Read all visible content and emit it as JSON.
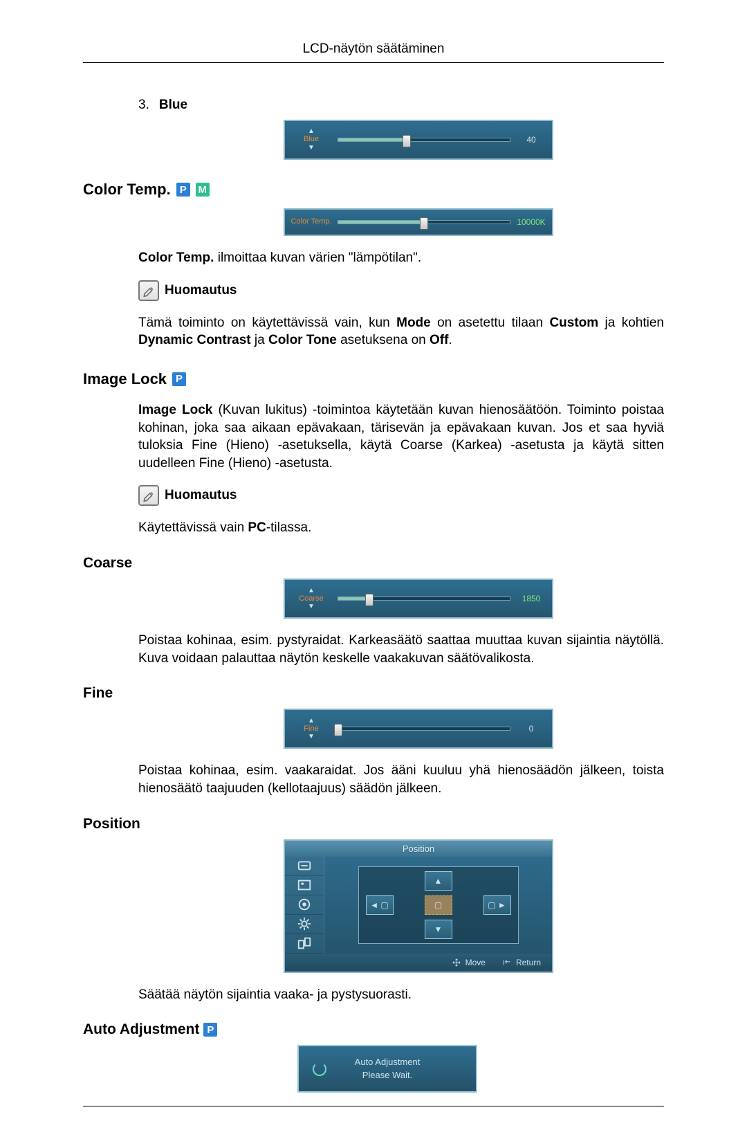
{
  "header": {
    "title": "LCD-näytön säätäminen"
  },
  "blue_item": {
    "num": "3.",
    "label": "Blue"
  },
  "blue_osd": {
    "label": "Blue",
    "value": "40",
    "percent": 40
  },
  "colortemp_heading": "Color Temp.",
  "colortemp_osd": {
    "label": "Color Temp.",
    "value": "10000K",
    "percent": 50
  },
  "colortemp_text_prefix": "Color Temp.",
  "colortemp_text_rest": " ilmoittaa kuvan värien \"lämpötilan\".",
  "note_label": "Huomautus",
  "colortemp_note": {
    "t1": "Tämä toiminto on käytettävissä vain, kun ",
    "b1": "Mode",
    "t2": " on asetettu tilaan ",
    "b2": "Custom",
    "t3": " ja kohtien ",
    "b3": "Dynamic Contrast",
    "t4": " ja ",
    "b4": "Color Tone",
    "t5": " asetuksena on ",
    "b5": "Off",
    "t6": "."
  },
  "imagelock_heading": "Image Lock",
  "imagelock_text": {
    "b1": "Image Lock",
    "rest": " (Kuvan lukitus) -toimintoa käytetään kuvan hienosäätöön. Toiminto poistaa kohinan, joka saa aikaan epävakaan, tärisevän ja epävakaan kuvan. Jos et saa hyviä tuloksia Fine (Hieno) -asetuksella, käytä Coarse (Karkea) -asetusta ja käytä sitten uudelleen Fine (Hieno) -asetusta."
  },
  "imagelock_note": {
    "t1": "Käytettävissä vain ",
    "b1": "PC",
    "t2": "-tilassa."
  },
  "coarse_heading": "Coarse",
  "coarse_osd": {
    "label": "Coarse",
    "value": "1850",
    "percent": 18
  },
  "coarse_text": "Poistaa kohinaa, esim. pystyraidat. Karkeasäätö saattaa muuttaa kuvan sijaintia näytöllä. Kuva voidaan palauttaa näytön keskelle vaakakuvan säätövalikosta.",
  "fine_heading": "Fine",
  "fine_osd": {
    "label": "Fine",
    "value": "0",
    "percent": 0
  },
  "fine_text": "Poistaa kohinaa, esim. vaakaraidat. Jos ääni kuuluu yhä hienosäädön jälkeen, toista hienosäätö taajuuden (kellotaajuus) säädön jälkeen.",
  "position_heading": "Position",
  "position_osd": {
    "title": "Position",
    "move": "Move",
    "return": "Return"
  },
  "position_text": "Säätää näytön sijaintia vaaka- ja pystysuorasti.",
  "autoadj_heading": "Auto Adjustment",
  "autoadj_box": {
    "line1": "Auto Adjustment",
    "line2": "Please Wait."
  },
  "badges": {
    "p": "P",
    "m": "M"
  }
}
